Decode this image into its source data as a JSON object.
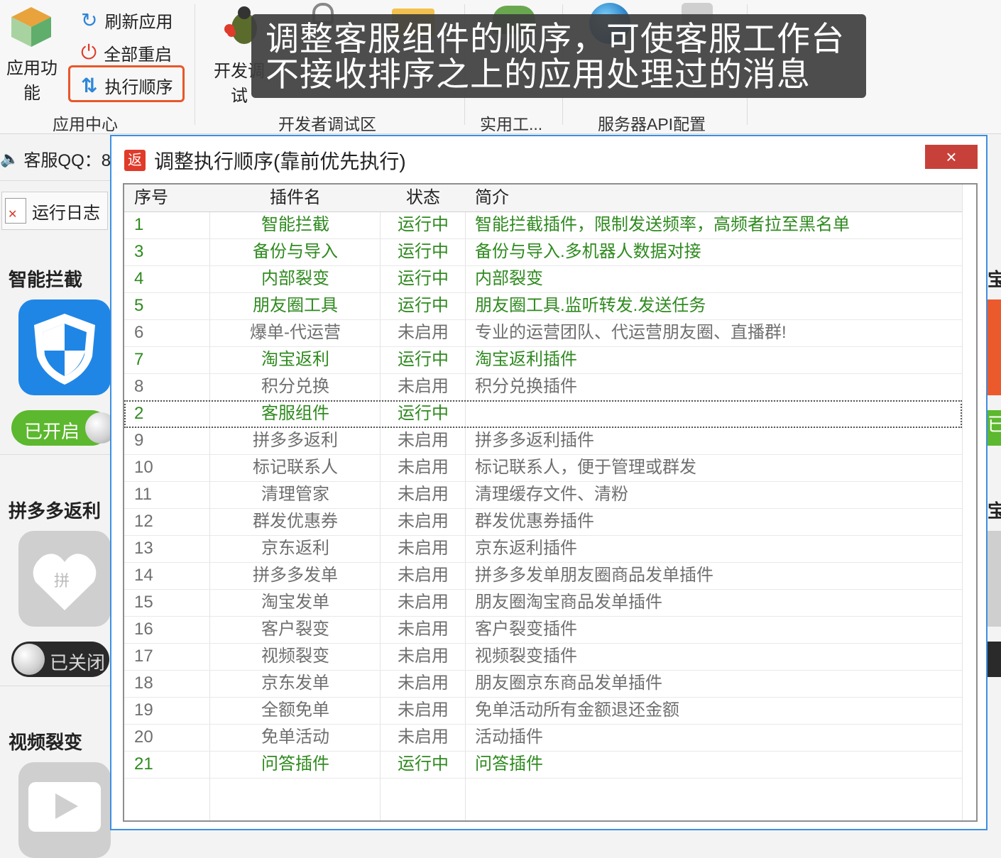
{
  "ribbon": {
    "app_function_label": "应用功能",
    "refresh_label": "刷新应用",
    "restart_label": "全部重启",
    "exec_order_label": "执行顺序",
    "app_center_group": "应用中心",
    "dev_debug_label": "开发调试",
    "dev_group": "开发者调试区",
    "tools_group": "实用工...",
    "server_group": "服务器API配置"
  },
  "tooltip": {
    "line1": "调整客服组件的顺序，可使客服工作台",
    "line2": "不接收排序之上的应用处理过的消息"
  },
  "left": {
    "qq_label": "客服QQ：8",
    "log_label": "运行日志",
    "cards": [
      {
        "title": "智能拦截",
        "toggle": "已开启"
      },
      {
        "title": "拼多多返利",
        "toggle": "已关闭"
      },
      {
        "title": "视频裂变"
      }
    ],
    "right_titles": [
      "宝",
      "宝"
    ],
    "right_toggle": "已"
  },
  "dialog": {
    "icon": "返",
    "title": "调整执行顺序(靠前优先执行)",
    "close": "×",
    "columns": [
      "序号",
      "插件名",
      "状态",
      "简介"
    ],
    "rows": [
      {
        "no": "1",
        "name": "智能拦截",
        "status": "运行中",
        "desc": "智能拦截插件，限制发送频率，高频者拉至黑名单"
      },
      {
        "no": "3",
        "name": "备份与导入",
        "status": "运行中",
        "desc": "备份与导入.多机器人数据对接"
      },
      {
        "no": "4",
        "name": "内部裂变",
        "status": "运行中",
        "desc": "内部裂变"
      },
      {
        "no": "5",
        "name": "朋友圈工具",
        "status": "运行中",
        "desc": "朋友圈工具.监听转发.发送任务"
      },
      {
        "no": "6",
        "name": "爆单-代运营",
        "status": "未启用",
        "desc": "专业的运营团队、代运营朋友圈、直播群!"
      },
      {
        "no": "7",
        "name": "淘宝返利",
        "status": "运行中",
        "desc": "淘宝返利插件"
      },
      {
        "no": "8",
        "name": "积分兑换",
        "status": "未启用",
        "desc": "积分兑换插件"
      },
      {
        "no": "2",
        "name": "客服组件",
        "status": "运行中",
        "desc": ""
      },
      {
        "no": "9",
        "name": "拼多多返利",
        "status": "未启用",
        "desc": "拼多多返利插件"
      },
      {
        "no": "10",
        "name": "标记联系人",
        "status": "未启用",
        "desc": "标记联系人，便于管理或群发"
      },
      {
        "no": "11",
        "name": "清理管家",
        "status": "未启用",
        "desc": "清理缓存文件、清粉"
      },
      {
        "no": "12",
        "name": "群发优惠券",
        "status": "未启用",
        "desc": "群发优惠券插件"
      },
      {
        "no": "13",
        "name": "京东返利",
        "status": "未启用",
        "desc": "京东返利插件"
      },
      {
        "no": "14",
        "name": "拼多多发单",
        "status": "未启用",
        "desc": "拼多多发单朋友圈商品发单插件"
      },
      {
        "no": "15",
        "name": "淘宝发单",
        "status": "未启用",
        "desc": "朋友圈淘宝商品发单插件"
      },
      {
        "no": "16",
        "name": "客户裂变",
        "status": "未启用",
        "desc": "客户裂变插件"
      },
      {
        "no": "17",
        "name": "视频裂变",
        "status": "未启用",
        "desc": "视频裂变插件"
      },
      {
        "no": "18",
        "name": "京东发单",
        "status": "未启用",
        "desc": "朋友圈京东商品发单插件"
      },
      {
        "no": "19",
        "name": "全额免单",
        "status": "未启用",
        "desc": "免单活动所有金额退还金额"
      },
      {
        "no": "20",
        "name": "免单活动",
        "status": "未启用",
        "desc": "活动插件"
      },
      {
        "no": "21",
        "name": "问答插件",
        "status": "运行中",
        "desc": "问答插件"
      }
    ]
  },
  "colors": {
    "running": "#2f8a1f",
    "disabled": "#6f6f6f",
    "highlight": "#e8572a",
    "dialog_border": "#3d8fe0"
  }
}
